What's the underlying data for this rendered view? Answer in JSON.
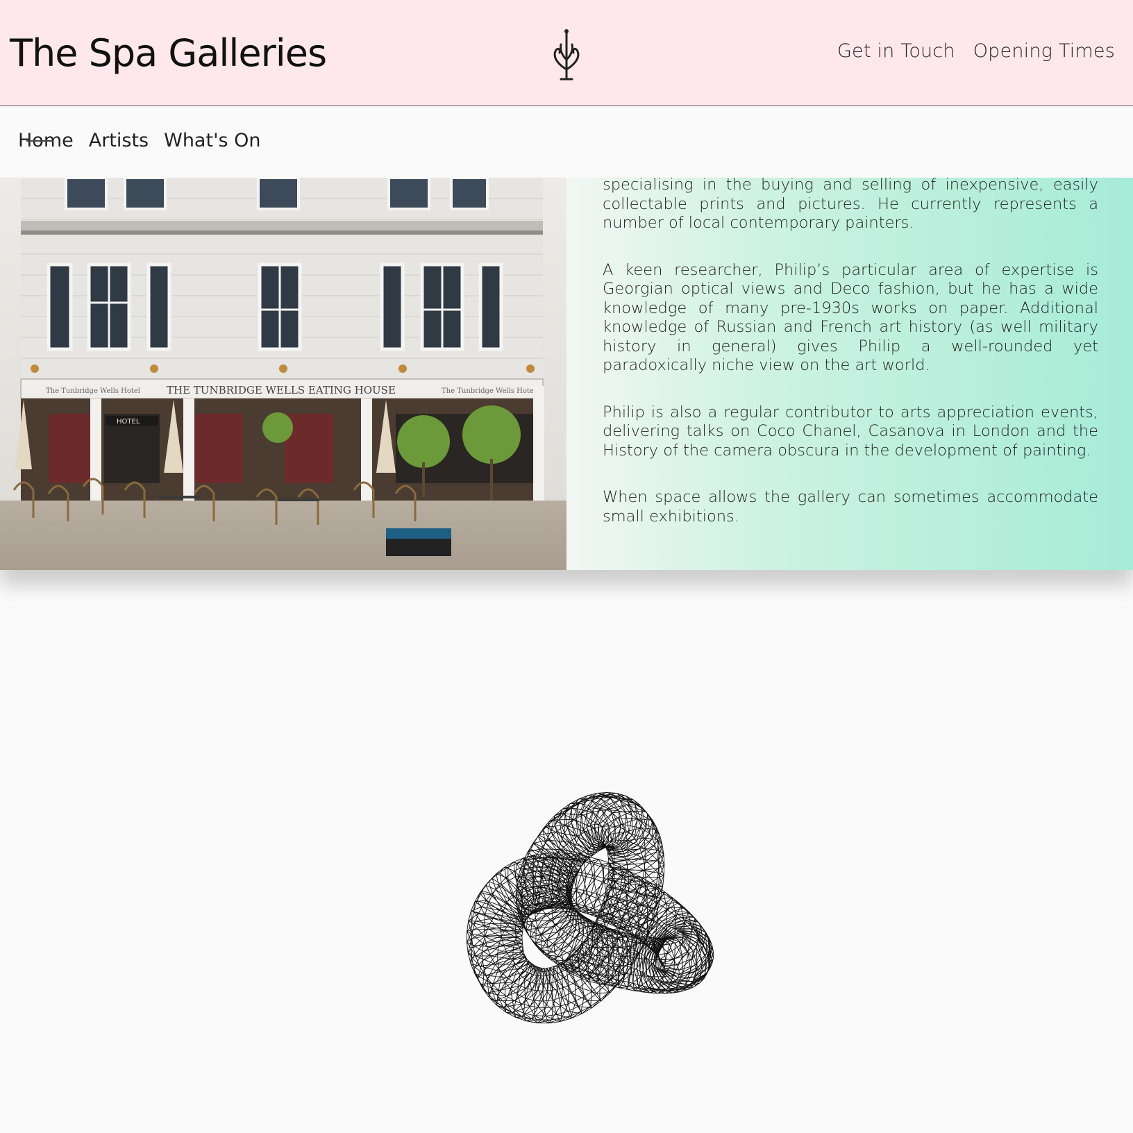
{
  "header": {
    "title": "The Spa Galleries",
    "links": [
      "Get in Touch",
      "Opening Times"
    ]
  },
  "nav": {
    "items": [
      "Home",
      "Artists",
      "What's On"
    ],
    "active": "Home"
  },
  "photo": {
    "sign_main": "THE TUNBRIDGE WELLS EATING HOUSE",
    "sign_left": "The Tunbridge Wells Hotel",
    "sign_right": "The Tunbridge Wells Hotel",
    "hotel_sign": "HOTEL"
  },
  "about": {
    "paragraphs": [
      "specialising in the buying and selling of inexpensive, easily collectable prints and pictures. He currently represents a number of local contemporary painters.",
      "A keen researcher, Philip’s particular area of expertise is Georgian optical views and Deco fashion, but he has a wide knowledge of many pre-1930s works on paper. Additional knowledge of Russian and French art history (as well military history in general) gives Philip a well-rounded yet paradoxically niche view on the art world.",
      "Philip is also a regular contributor to arts appreciation events, delivering talks on Coco Chanel, Casanova in London and the History of the camera obscura in the development of painting.",
      "When space allows the gallery can sometimes accommodate small exhibitions."
    ]
  },
  "colors": {
    "header_bg": "#ffe8ec",
    "panel_gradient_start": "#f2f7f3",
    "panel_gradient_end": "#a6ecd6",
    "page_bg": "#fafafa"
  },
  "icons": {
    "logo": "fountain-icon",
    "graphic": "wireframe-torus-knot"
  }
}
